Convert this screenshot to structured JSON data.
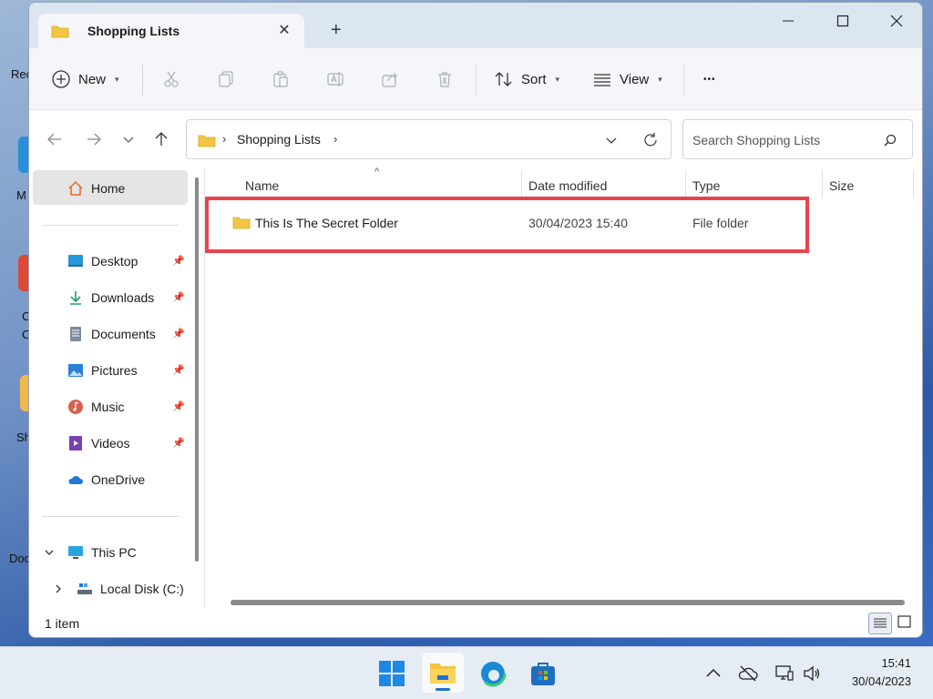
{
  "desktop": {
    "labels": [
      "Rec",
      "M",
      "C",
      "C",
      "Sh",
      "Doc"
    ]
  },
  "window": {
    "tab_title": "Shopping Lists",
    "tab_close": "✕",
    "new_tab": "+"
  },
  "toolbar": {
    "new_label": "New",
    "sort_label": "Sort",
    "view_label": "View",
    "more_label": "•••"
  },
  "address": {
    "crumb": "Shopping Lists",
    "search_placeholder": "Search Shopping Lists"
  },
  "sidebar": {
    "home": "Home",
    "items": [
      {
        "label": "Desktop",
        "pinned": true
      },
      {
        "label": "Downloads",
        "pinned": true
      },
      {
        "label": "Documents",
        "pinned": true
      },
      {
        "label": "Pictures",
        "pinned": true
      },
      {
        "label": "Music",
        "pinned": true
      },
      {
        "label": "Videos",
        "pinned": true
      },
      {
        "label": "OneDrive",
        "pinned": false
      }
    ],
    "this_pc": "This PC",
    "local_disk": "Local Disk (C:)"
  },
  "columns": {
    "name": "Name",
    "date": "Date modified",
    "type": "Type",
    "size": "Size"
  },
  "files": [
    {
      "name": "This Is The Secret Folder",
      "date": "30/04/2023 15:40",
      "type": "File folder",
      "size": ""
    }
  ],
  "status": {
    "count": "1 item"
  },
  "taskbar": {
    "time": "15:41",
    "date": "30/04/2023"
  },
  "colors": {
    "highlight": "#e8434d",
    "folder": "#f4c542",
    "accent": "#1b6fd6"
  }
}
